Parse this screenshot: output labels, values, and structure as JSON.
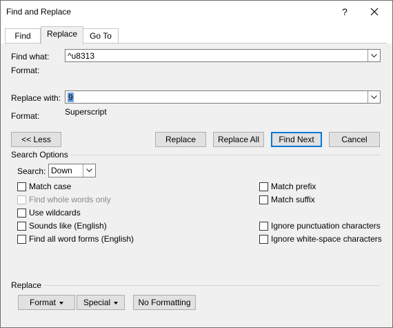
{
  "window": {
    "title": "Find and Replace",
    "help": "?",
    "close_icon": "close-icon"
  },
  "tabs": [
    {
      "label": "Find",
      "active": false
    },
    {
      "label": "Replace",
      "active": true
    },
    {
      "label": "Go To",
      "active": false
    }
  ],
  "find": {
    "label": "Find what:",
    "value": "^u8313",
    "format_label": "Format:",
    "format_value": ""
  },
  "replace": {
    "label": "Replace with:",
    "value": "9",
    "format_label": "Format:",
    "format_value": "Superscript"
  },
  "buttons": {
    "less": "<< Less",
    "replace": "Replace",
    "replace_all": "Replace All",
    "find_next": "Find Next",
    "cancel": "Cancel"
  },
  "search_options": {
    "title": "Search Options",
    "search_label": "Search:",
    "search_value": "Down",
    "left": [
      {
        "label": "Match case",
        "checked": false,
        "disabled": false
      },
      {
        "label": "Find whole words only",
        "checked": false,
        "disabled": true
      },
      {
        "label": "Use wildcards",
        "checked": false,
        "disabled": false
      },
      {
        "label": "Sounds like (English)",
        "checked": false,
        "disabled": false
      },
      {
        "label": "Find all word forms (English)",
        "checked": false,
        "disabled": false
      }
    ],
    "right": [
      {
        "label": "Match prefix",
        "checked": false
      },
      {
        "label": "Match suffix",
        "checked": false
      },
      {
        "label": "Ignore punctuation characters",
        "checked": false
      },
      {
        "label": "Ignore white-space characters",
        "checked": false
      }
    ]
  },
  "replace_section": {
    "title": "Replace",
    "format": "Format",
    "special": "Special",
    "no_formatting": "No Formatting"
  }
}
